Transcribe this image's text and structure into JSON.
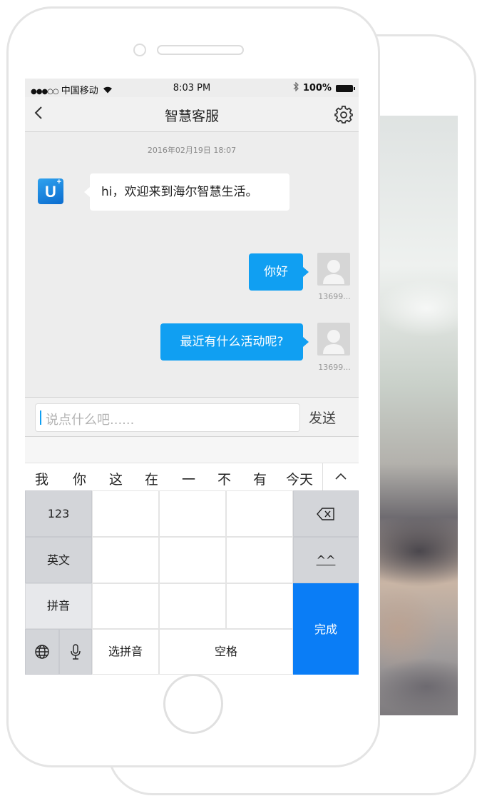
{
  "status_bar": {
    "signal": "●●●○○",
    "carrier": "中国移动",
    "time": "8:03 PM",
    "battery": "100%"
  },
  "nav": {
    "title": "智慧客服",
    "back_icon": "chevron-left-icon",
    "settings_icon": "gear-icon"
  },
  "chat": {
    "timestamp": "2016年02月19日 18:07",
    "messages": [
      {
        "from": "service",
        "text": "hi，欢迎来到海尔智慧生活。"
      },
      {
        "from": "user",
        "text": "你好",
        "name": "13699..."
      },
      {
        "from": "user",
        "text": "最近有什么活动呢?",
        "name": "13699..."
      }
    ],
    "service_avatar": "U",
    "service_avatar_sup": "+"
  },
  "input": {
    "placeholder": "说点什么吧......",
    "send_label": "发送"
  },
  "keyboard": {
    "candidates": [
      "我",
      "你",
      "这",
      "在",
      "一",
      "不",
      "有",
      "今天"
    ],
    "collapse_label": "^",
    "key_123": "123",
    "key_english": "英文",
    "key_pinyin": "拼音",
    "key_emoticon": "^^",
    "key_select_pinyin": "选拼音",
    "key_space": "空格",
    "key_done": "完成"
  },
  "colors": {
    "accent_blue": "#109ff2",
    "done_blue": "#0a7df6"
  }
}
